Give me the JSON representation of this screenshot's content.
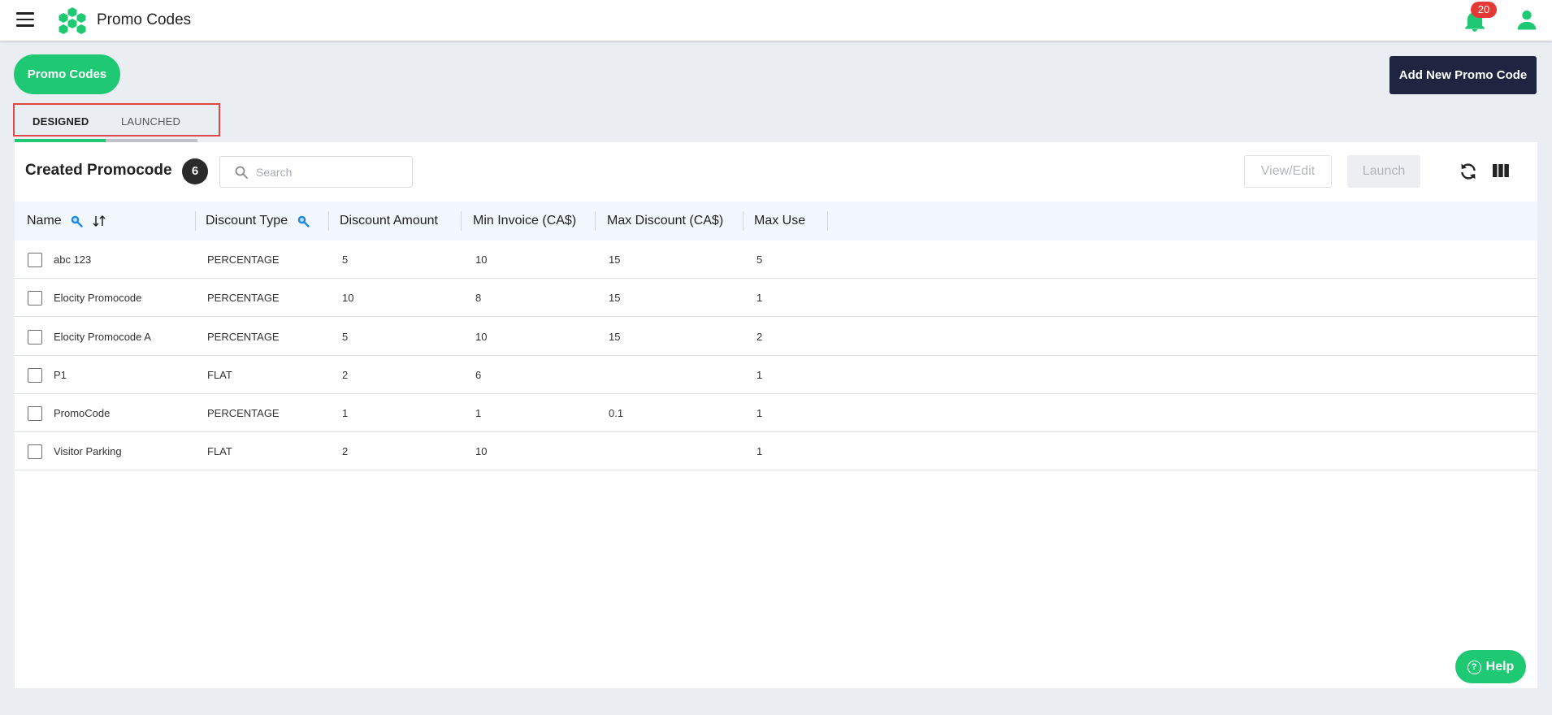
{
  "header": {
    "app_title": "Promo Codes",
    "notification_count": "20"
  },
  "toolbar": {
    "promo_codes_label": "Promo Codes",
    "add_new_label": "Add New Promo Code"
  },
  "tabs": [
    {
      "label": "DESIGNED",
      "active": true
    },
    {
      "label": "LAUNCHED",
      "active": false
    }
  ],
  "card": {
    "title": "Created Promocode",
    "count": "6",
    "search_placeholder": "Search",
    "view_edit_label": "View/Edit",
    "launch_label": "Launch"
  },
  "table": {
    "columns": [
      "Name",
      "Discount Type",
      "Discount Amount",
      "Min Invoice (CA$)",
      "Max Discount (CA$)",
      "Max Use"
    ],
    "rows": [
      [
        "abc 123",
        "PERCENTAGE",
        "5",
        "10",
        "15",
        "5"
      ],
      [
        "Elocity Promocode",
        "PERCENTAGE",
        "10",
        "8",
        "15",
        "1"
      ],
      [
        "Elocity Promocode A",
        "PERCENTAGE",
        "5",
        "10",
        "15",
        "2"
      ],
      [
        "P1",
        "FLAT",
        "2",
        "6",
        "",
        "1"
      ],
      [
        "PromoCode",
        "PERCENTAGE",
        "1",
        "1",
        "0.1",
        "1"
      ],
      [
        "Visitor Parking",
        "FLAT",
        "2",
        "10",
        "",
        "1"
      ]
    ]
  },
  "help": {
    "label": "Help"
  },
  "colors": {
    "accent_green": "#1fc872",
    "dark_navy": "#1f2541",
    "badge_red": "#e53935",
    "tab_highlight_border": "#e04848"
  },
  "icons": [
    "menu-icon",
    "logo-icon",
    "bell-icon",
    "user-icon",
    "search-icon",
    "refresh-icon",
    "columns-icon",
    "sort-icon",
    "help-icon"
  ]
}
